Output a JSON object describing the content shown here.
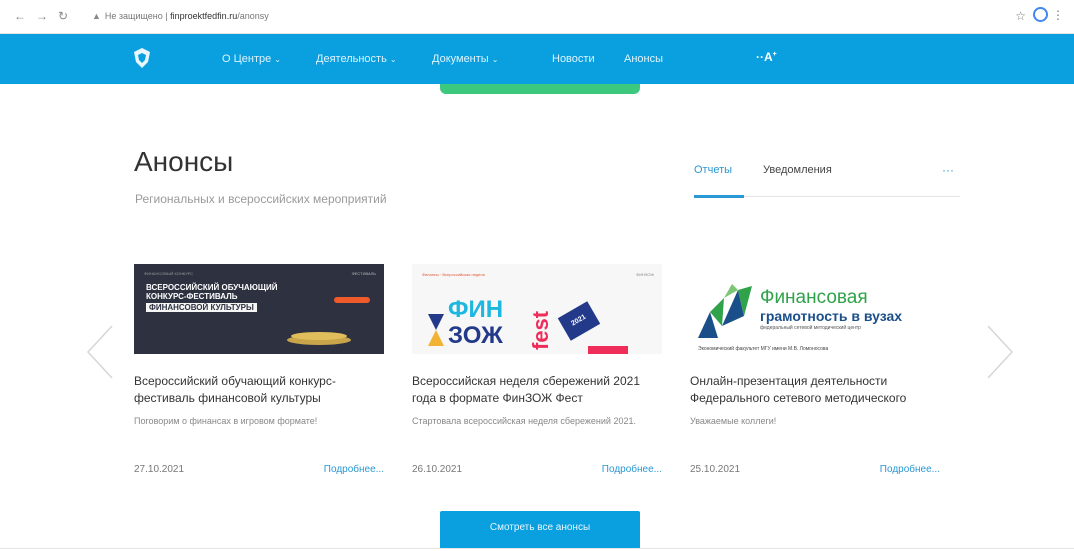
{
  "browser": {
    "security_label": "Не защищено",
    "separator": "|",
    "host": "finproektfedfin.ru",
    "path": "/anonsy"
  },
  "nav": {
    "items": [
      {
        "label": "О Центре",
        "has_dropdown": true
      },
      {
        "label": "Деятельность",
        "has_dropdown": true
      },
      {
        "label": "Документы",
        "has_dropdown": true
      },
      {
        "label": "Новости",
        "has_dropdown": false
      },
      {
        "label": "Анонсы",
        "has_dropdown": false
      }
    ],
    "font_size_toggle": "A",
    "chevron": "⌄"
  },
  "section": {
    "title": "Анонсы",
    "subtitle": "Региональных и всероссийских мероприятий",
    "tabs": [
      {
        "label": "Отчеты",
        "active": true
      },
      {
        "label": "Уведомления",
        "active": false
      }
    ],
    "tab_more": "···"
  },
  "cards": [
    {
      "image": {
        "tag_left": "ФИНАНСОВЫЙ КОНКУРС",
        "tag_right": "ФЕСТИВАЛЬ",
        "line1": "ВСЕРОССИЙСКИЙ ОБУЧАЮЩИЙ",
        "line2": "КОНКУРС-ФЕСТИВАЛЬ",
        "line3": "ФИНАНСОВОЙ КУЛЬТУРЫ"
      },
      "title": "Всероссийский обучающий конкурс-фестиваль финансовой культуры",
      "description": "Поговорим о финансах в игровом формате!",
      "date": "27.10.2021",
      "more": "Подробнее..."
    },
    {
      "image": {
        "tag_left": "Финансы · Всероссийская неделя",
        "tag_right": "ФИНЗОЖ",
        "fin": "ФИН",
        "zozh": "ЗОЖ",
        "fest": "fest",
        "year": "2021"
      },
      "title": "Всероссийская неделя сбережений 2021 года в формате ФинЗОЖ Фест",
      "description": "Стартовала всероссийская неделя сбережений 2021.",
      "date": "26.10.2021",
      "more": "Подробнее..."
    },
    {
      "image": {
        "heading": "Финансовая",
        "subheading": "грамотность в вузах",
        "caption": "федеральный сетевой методический центр",
        "footer": "Экономический факультет МГУ имени М.В. Ломоносова"
      },
      "title": "Онлайн-презентация деятельности Федерального сетевого методического",
      "description": "Уважаемые коллеги!",
      "date": "25.10.2021",
      "more": "Подробнее..."
    }
  ],
  "view_all_label": "Смотреть все анонсы",
  "colors": {
    "brand_blue": "#0aa0e0",
    "accent_green": "#3cc87d",
    "link_blue": "#2a98d4"
  }
}
